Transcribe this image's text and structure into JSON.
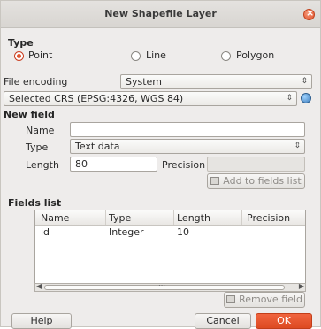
{
  "window": {
    "title": "New Shapefile Layer"
  },
  "type_section": {
    "label": "Type",
    "options": [
      "Point",
      "Line",
      "Polygon"
    ],
    "selected": "Point"
  },
  "file_encoding": {
    "label": "File encoding",
    "value": "System"
  },
  "crs": {
    "value": "Selected CRS (EPSG:4326, WGS 84)"
  },
  "new_field": {
    "label": "New field",
    "name_label": "Name",
    "name_value": "",
    "type_label": "Type",
    "type_value": "Text data",
    "length_label": "Length",
    "length_value": "80",
    "precision_label": "Precision",
    "precision_value": "",
    "add_button": "Add to fields list"
  },
  "fields_list": {
    "label": "Fields list",
    "columns": [
      "Name",
      "Type",
      "Length",
      "Precision"
    ],
    "rows": [
      {
        "name": "id",
        "type": "Integer",
        "length": "10",
        "precision": ""
      }
    ],
    "scroll_grip": "⋯",
    "remove_button": "Remove field"
  },
  "footer": {
    "help": "Help",
    "cancel": "Cancel",
    "ok": "OK"
  },
  "colors": {
    "accent": "#e0532d",
    "dialog_bg": "#eeeceb"
  }
}
